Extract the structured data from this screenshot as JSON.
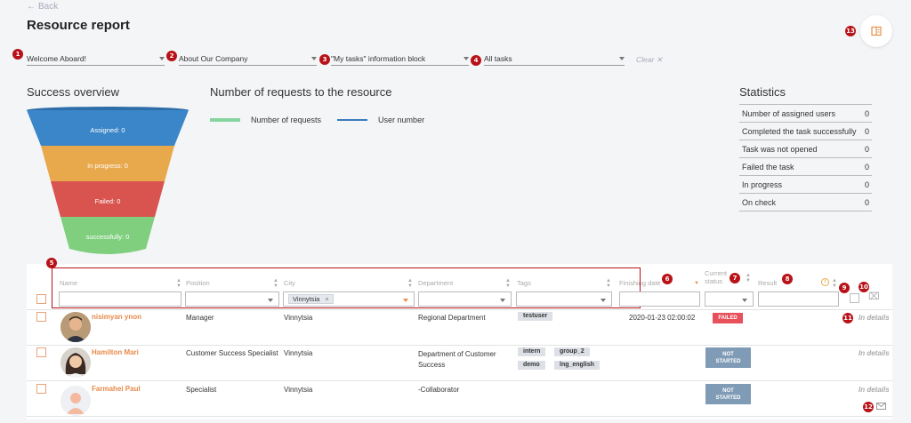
{
  "header": {
    "back_label": "Back",
    "title": "Resource report"
  },
  "filters": [
    {
      "value": "Welcome Aboard!"
    },
    {
      "value": "About Our Company"
    },
    {
      "value": "\"My tasks\" information block"
    },
    {
      "value": "All tasks"
    }
  ],
  "clear_label": "Clear ✕",
  "badges": {
    "b1": "1",
    "b2": "2",
    "b3": "3",
    "b4": "4",
    "b5": "5",
    "b6": "6",
    "b7": "7",
    "b8": "8",
    "b9": "9",
    "b10": "10",
    "b11": "11",
    "b12": "12",
    "b13": "13"
  },
  "overview": {
    "title": "Success overview",
    "stages": [
      {
        "label": "Assigned: 0",
        "color": "#3a86c8"
      },
      {
        "label": "In progress: 0",
        "color": "#e8a84c"
      },
      {
        "label": "Failed: 0",
        "color": "#d9534f"
      },
      {
        "label": "successfully: 0",
        "color": "#7fcf7f"
      }
    ]
  },
  "requests": {
    "title": "Number of requests to the resource",
    "legend": [
      {
        "label": "Number of requests",
        "color": "#86d4a0"
      },
      {
        "label": "User number",
        "color": "#3a7bbf"
      }
    ]
  },
  "statistics": {
    "title": "Statistics",
    "rows": [
      {
        "label": "Number of assigned users",
        "value": "0"
      },
      {
        "label": "Completed the task successfully",
        "value": "0"
      },
      {
        "label": "Task was not opened",
        "value": "0"
      },
      {
        "label": "Failed the task",
        "value": "0"
      },
      {
        "label": "In progress",
        "value": "0"
      },
      {
        "label": "On check",
        "value": "0"
      }
    ]
  },
  "table": {
    "columns": {
      "name": "Name",
      "position": "Position",
      "city": "City",
      "department": "Department",
      "tags": "Tags",
      "finishing_date": "Finishing date",
      "current_status_1": "Current",
      "current_status_2": "status",
      "result": "Result"
    },
    "city_filter_chip": "Vinnytsia",
    "rows": [
      {
        "name": "nisimyan ynon",
        "position": "Manager",
        "city": "Vinnytsia",
        "department_1": "Regional Department",
        "department_2": "",
        "tags": [
          "testuser"
        ],
        "finishing_date": "2020-01-23 02:00:02",
        "status_1": "FAILED",
        "status_2": "",
        "status_color": "#e8505b",
        "details": "In details"
      },
      {
        "name": "Hamilton Mari",
        "position": "Customer Success Specialist",
        "city": "Vinnytsia",
        "department_1": "Department of Customer",
        "department_2": "Success",
        "tags": [
          "intern",
          "group_2",
          "demo",
          "lng_english"
        ],
        "finishing_date": "",
        "status_1": "NOT",
        "status_2": "STARTED",
        "status_color": "#7f9bb5",
        "details": "In details"
      },
      {
        "name": "Farmahei Paul",
        "position": "Specialist",
        "city": "Vinnytsia",
        "department_1": "-Collaborator",
        "department_2": "",
        "tags": [],
        "finishing_date": "",
        "status_1": "NOT",
        "status_2": "STARTED",
        "status_color": "#7f9bb5",
        "details": "In details"
      }
    ]
  }
}
